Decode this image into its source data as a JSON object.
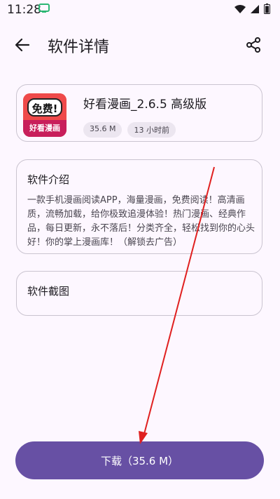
{
  "status_bar": {
    "time": "11:28"
  },
  "appbar": {
    "title": "软件详情"
  },
  "app": {
    "name": "好看漫画_2.6.5 高级版",
    "icon_top_text": "免费!",
    "icon_bottom_text": "好看漫画",
    "size": "35.6 M",
    "updated": "13 小时前"
  },
  "intro": {
    "title": "软件介绍",
    "text": "一款手机漫画阅读APP，海量漫画，免费阅读！高清画质，流畅加载，给你极致追漫体验！热门漫画、经典作品，每日更新，永不落后！分类齐全，轻松找到你的心头好！你的掌上漫画库！（解锁去广告）"
  },
  "screenshots": {
    "title": "软件截图"
  },
  "download": {
    "label": "下载（35.6 M）"
  },
  "colors": {
    "background": "#fdf7ff",
    "primary": "#6750a4",
    "annotation": "#e02020"
  },
  "icons": [
    "app-notification-icon",
    "wifi-icon",
    "signal-icon",
    "battery-icon",
    "back-arrow-icon",
    "share-icon"
  ]
}
